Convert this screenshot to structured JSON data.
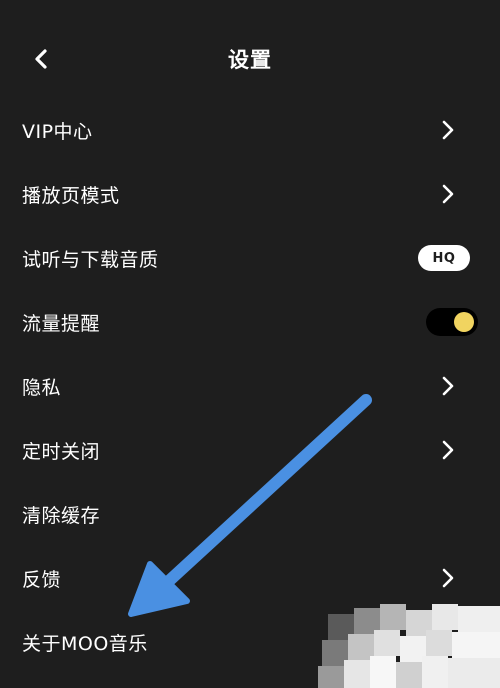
{
  "header": {
    "title": "设置",
    "back_icon": "chevron-left-icon"
  },
  "menu": {
    "items": [
      {
        "label": "VIP中心",
        "accessory": "chevron"
      },
      {
        "label": "播放页模式",
        "accessory": "chevron"
      },
      {
        "label": "试听与下载音质",
        "accessory": "badge",
        "badge": "HQ"
      },
      {
        "label": "流量提醒",
        "accessory": "toggle",
        "toggle_on": true
      },
      {
        "label": "隐私",
        "accessory": "chevron"
      },
      {
        "label": "定时关闭",
        "accessory": "chevron"
      },
      {
        "label": "清除缓存",
        "accessory": "none"
      },
      {
        "label": "反馈",
        "accessory": "chevron"
      },
      {
        "label": "关于MOO音乐",
        "accessory": "none"
      }
    ]
  },
  "colors": {
    "background": "#1e1e1e",
    "text": "#ffffff",
    "toggle_knob": "#f1d460",
    "toggle_track": "#000000",
    "annotation_arrow": "#4a90e2"
  }
}
